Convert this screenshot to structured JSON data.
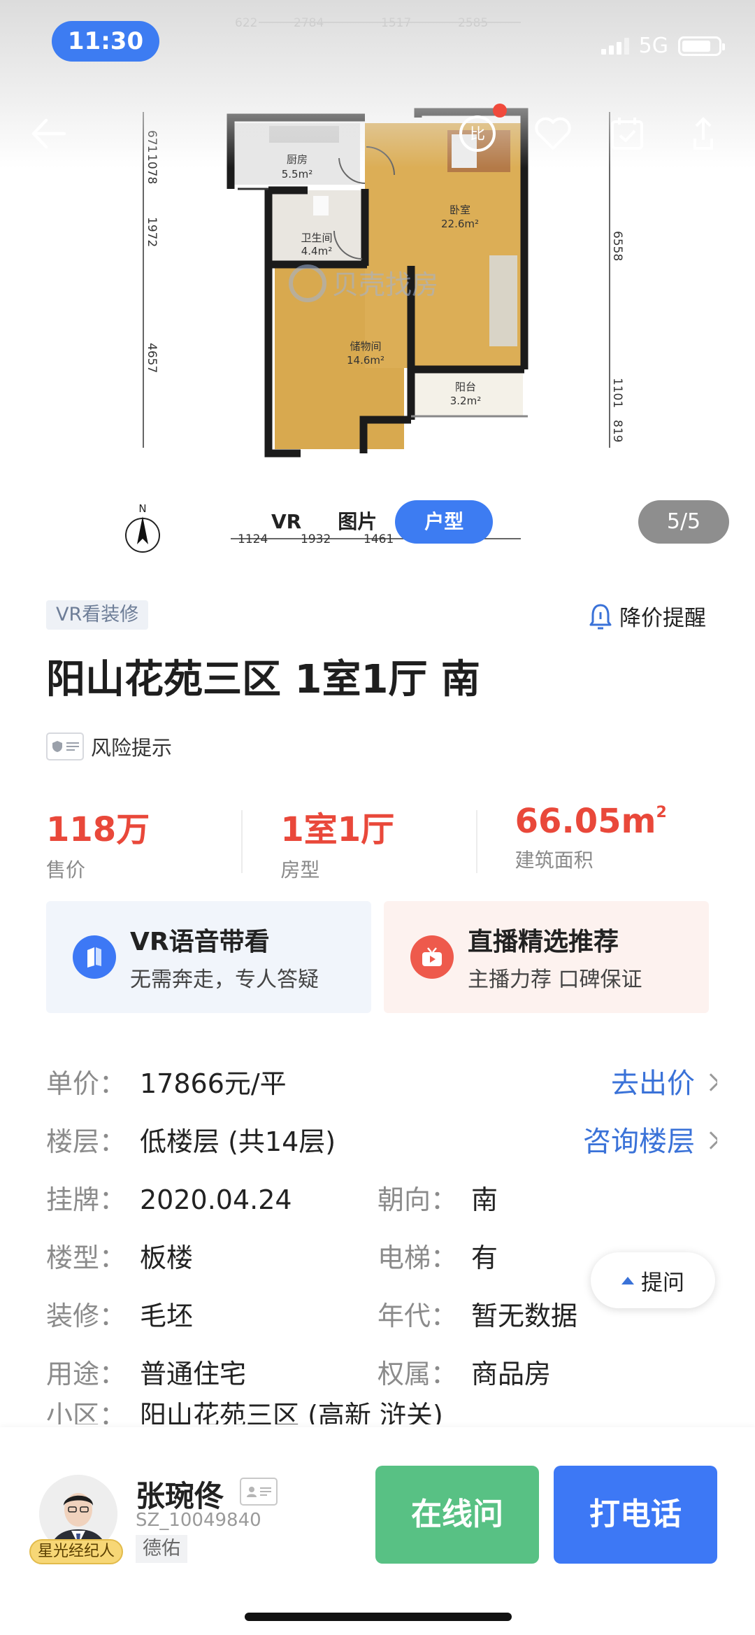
{
  "status": {
    "time": "11:30",
    "network": "5G"
  },
  "floorplan": {
    "watermark": "贝壳找房",
    "rooms": [
      {
        "name": "厨房",
        "area": "5.5m²"
      },
      {
        "name": "卫生间",
        "area": "4.4m²"
      },
      {
        "name": "卧室",
        "area": "22.6m²"
      },
      {
        "name": "储物间",
        "area": "14.6m²"
      },
      {
        "name": "阳台",
        "area": "3.2m²"
      }
    ],
    "dims_top": [
      "622",
      "2784",
      "1517",
      "2585"
    ],
    "dims_left": [
      "671",
      "1078",
      "1972",
      "4657"
    ],
    "dims_right": [
      "6558",
      "1101",
      "819"
    ],
    "dims_bottom": [
      "1124",
      "1932",
      "1461"
    ],
    "compass": "N"
  },
  "gallery": {
    "tabs": [
      {
        "label": "VR"
      },
      {
        "label": "图片"
      },
      {
        "label": "户型"
      }
    ],
    "counter": "5/5"
  },
  "listing": {
    "tag": "VR看装修",
    "price_alert": "降价提醒",
    "title": "阳山花苑三区 1室1厅 南",
    "risk": "风险提示",
    "stats": [
      {
        "value": "118万",
        "label": "售价"
      },
      {
        "value": "1室1厅",
        "label": "房型"
      },
      {
        "value": "66.05m",
        "sup": "2",
        "label": "建筑面积"
      }
    ],
    "promo": [
      {
        "title": "VR语音带看",
        "subtitle": "无需奔走，专人答疑"
      },
      {
        "title": "直播精选推荐",
        "subtitle": "主播力荐 口碑保证"
      }
    ],
    "details": {
      "unit_price_label": "单价：",
      "unit_price": "17866元/平",
      "offer_link": "去出价",
      "floor_label": "楼层：",
      "floor": "低楼层 (共14层)",
      "floor_link": "咨询楼层",
      "listed_label": "挂牌：",
      "listed": "2020.04.24",
      "orientation_label": "朝向：",
      "orientation": "南",
      "building_label": "楼型：",
      "building": "板楼",
      "elevator_label": "电梯：",
      "elevator": "有",
      "decor_label": "装修：",
      "decor": "毛坯",
      "year_label": "年代：",
      "year": "暂无数据",
      "usage_label": "用途：",
      "usage": "普通住宅",
      "ownership_label": "权属：",
      "ownership": "商品房",
      "community_label": "小区：",
      "community": "阳山花苑三区 (高新 浒关)"
    },
    "ask_button": "提问"
  },
  "agent": {
    "name": "张琬佟",
    "id": "SZ_10049840",
    "company": "德佑",
    "badge": "星光经纪人",
    "online_button": "在线问",
    "call_button": "打电话"
  },
  "colors": {
    "accent": "#3d7cf2",
    "price": "#e9483a",
    "online": "#58c184",
    "call": "#3d78f5",
    "link": "#3a72d8"
  }
}
